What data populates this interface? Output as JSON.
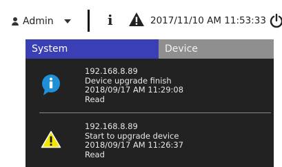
{
  "topbar": {
    "user_name": "Admin",
    "user_icon": "user-icon",
    "info_icon": "info-icon",
    "alert_icon": "warning-icon",
    "datetime": "2017/11/10 AM 11:53:33",
    "power_icon": "power-icon"
  },
  "tabs": [
    {
      "label": "System",
      "active": true
    },
    {
      "label": "Device",
      "active": false
    }
  ],
  "notifications": [
    {
      "icon": "info-icon",
      "ip": "192.168.8.89",
      "message": "Device upgrade finish",
      "timestamp": "2018/09/17 AM 11:29:08",
      "status": "Read"
    },
    {
      "icon": "warning-icon",
      "ip": "192.168.8.89",
      "message": "Start to upgrade device",
      "timestamp": "2018/09/17 AM 11:26:37",
      "status": "Read"
    }
  ],
  "colors": {
    "active_tab": "#3b3fb6",
    "inactive_tab": "#8f8f8f",
    "panel_bg": "#222222",
    "info_blue": "#1f8fd6",
    "warning_yellow": "#f2e600"
  }
}
